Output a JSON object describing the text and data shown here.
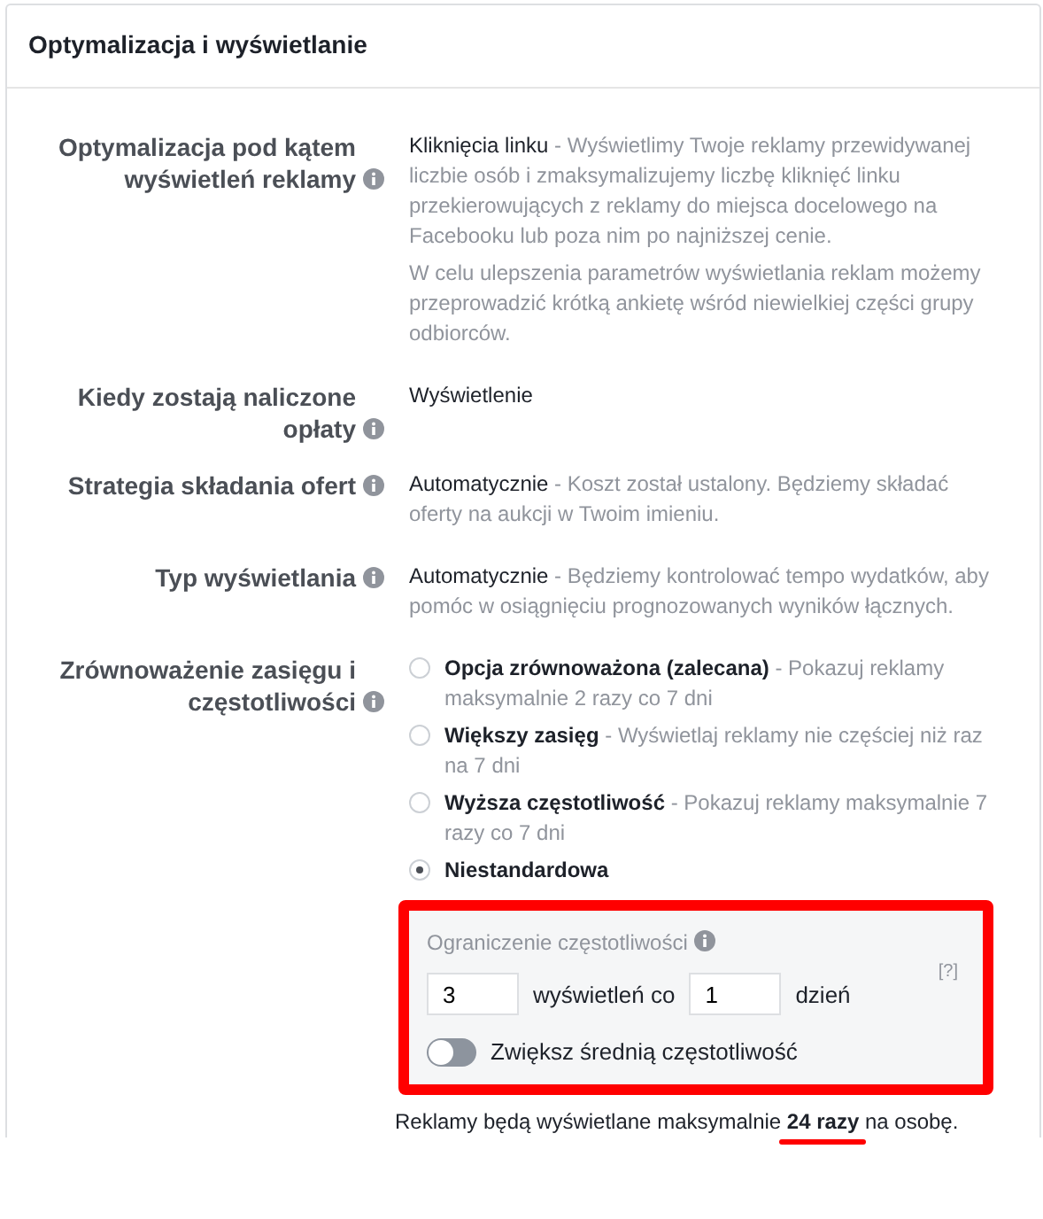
{
  "title": "Optymalizacja i wyświetlanie",
  "rows": [
    {
      "label": "Optymalizacja pod kątem wyświetleń reklamy",
      "kind": "text",
      "paragraphs": [
        {
          "lead": "Kliknięcia linku",
          "text": " - Wyświetlimy Twoje reklamy przewidywanej liczbie osób i zmaksymalizujemy liczbę kliknięć linku przekierowujących z reklamy do miejsca docelowego na Facebooku lub poza nim po najniższej cenie."
        },
        {
          "text": "W celu ulepszenia parametrów wyświetlania reklam możemy przeprowadzić krótką ankietę wśród niewielkiej części grupy odbiorców."
        }
      ]
    },
    {
      "label": "Kiedy zostają naliczone opłaty",
      "kind": "text",
      "paragraphs": [
        {
          "lead": "Wyświetlenie"
        }
      ]
    },
    {
      "label": "Strategia składania ofert",
      "kind": "text",
      "paragraphs": [
        {
          "lead": "Automatycznie",
          "text": " - Koszt został ustalony. Będziemy składać oferty na aukcji w Twoim imieniu."
        }
      ]
    },
    {
      "label": "Typ wyświetlania",
      "kind": "text",
      "paragraphs": [
        {
          "lead": "Automatycznie",
          "text": " - Będziemy kontrolować tempo wydatków, aby pomóc w osiągnięciu prognozowanych wyników łącznych."
        }
      ]
    },
    {
      "label": "Zrównoważenie zasięgu i częstotliwości",
      "kind": "radios",
      "options": [
        {
          "title": "Opcja zrównoważona (zalecana)",
          "text": " - Pokazuj reklamy maksymalnie 2 razy co 7 dni",
          "selected": false
        },
        {
          "title": "Większy zasięg",
          "text": " - Wyświetlaj reklamy nie częściej niż raz na 7 dni",
          "selected": false
        },
        {
          "title": "Wyższa częstotliwość",
          "text": " - Pokazuj reklamy maksymalnie 7 razy co 7 dni",
          "selected": false
        },
        {
          "title": "Niestandardowa",
          "selected": true
        }
      ]
    }
  ],
  "frequency_cap": {
    "title": "Ograniczenie częstotliwości",
    "help": "[?]",
    "impressions": "3",
    "impressions_unit": "wyświetleń co",
    "days": "1",
    "days_unit": "dzień",
    "toggle": {
      "label": "Zwiększ średnią częstotliwość",
      "on": false
    }
  },
  "summary": "Reklamy będą wyświetlane maksymalnie **24 razy** na osobę."
}
